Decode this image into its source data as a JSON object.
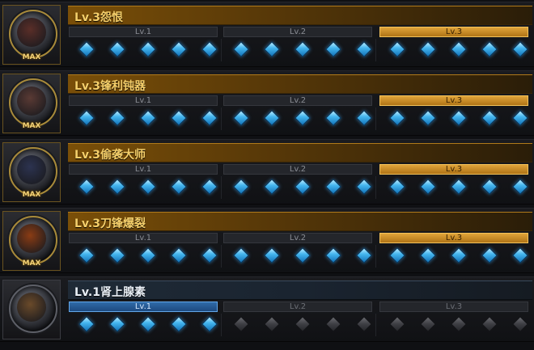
{
  "skills": [
    {
      "title": "Lv.3怨恨",
      "badge": "MAX",
      "maxed": true,
      "portrait_color": "#5a2e28",
      "icon": "rage-portrait-icon",
      "tiers": [
        {
          "label": "Lv.1",
          "state": "inactive"
        },
        {
          "label": "Lv.2",
          "state": "inactive"
        },
        {
          "label": "Lv.3",
          "state": "active"
        }
      ],
      "gems_lit": [
        true,
        true,
        true
      ]
    },
    {
      "title": "Lv.3锋利钝器",
      "badge": "MAX",
      "maxed": true,
      "portrait_color": "#5a3a34",
      "icon": "blunt-weapon-portrait-icon",
      "tiers": [
        {
          "label": "Lv.1",
          "state": "inactive"
        },
        {
          "label": "Lv.2",
          "state": "inactive"
        },
        {
          "label": "Lv.3",
          "state": "active"
        }
      ],
      "gems_lit": [
        true,
        true,
        true
      ]
    },
    {
      "title": "Lv.3偷袭大师",
      "badge": "MAX",
      "maxed": true,
      "portrait_color": "#2c3350",
      "icon": "ambush-portrait-icon",
      "tiers": [
        {
          "label": "Lv.1",
          "state": "inactive"
        },
        {
          "label": "Lv.2",
          "state": "inactive"
        },
        {
          "label": "Lv.3",
          "state": "active"
        }
      ],
      "gems_lit": [
        true,
        true,
        true
      ]
    },
    {
      "title": "Lv.3刀锋爆裂",
      "badge": "MAX",
      "maxed": true,
      "portrait_color": "#8a3c14",
      "icon": "blade-burst-portrait-icon",
      "tiers": [
        {
          "label": "Lv.1",
          "state": "inactive"
        },
        {
          "label": "Lv.2",
          "state": "inactive"
        },
        {
          "label": "Lv.3",
          "state": "active"
        }
      ],
      "gems_lit": [
        true,
        true,
        true
      ]
    },
    {
      "title": "Lv.1肾上腺素",
      "badge": "",
      "maxed": false,
      "portrait_color": "#6a4a2a",
      "icon": "adrenaline-portrait-icon",
      "tiers": [
        {
          "label": "Lv.1",
          "state": "current"
        },
        {
          "label": "Lv.2",
          "state": "locked"
        },
        {
          "label": "Lv.3",
          "state": "locked"
        }
      ],
      "gems_lit": [
        true,
        false,
        false
      ]
    }
  ]
}
